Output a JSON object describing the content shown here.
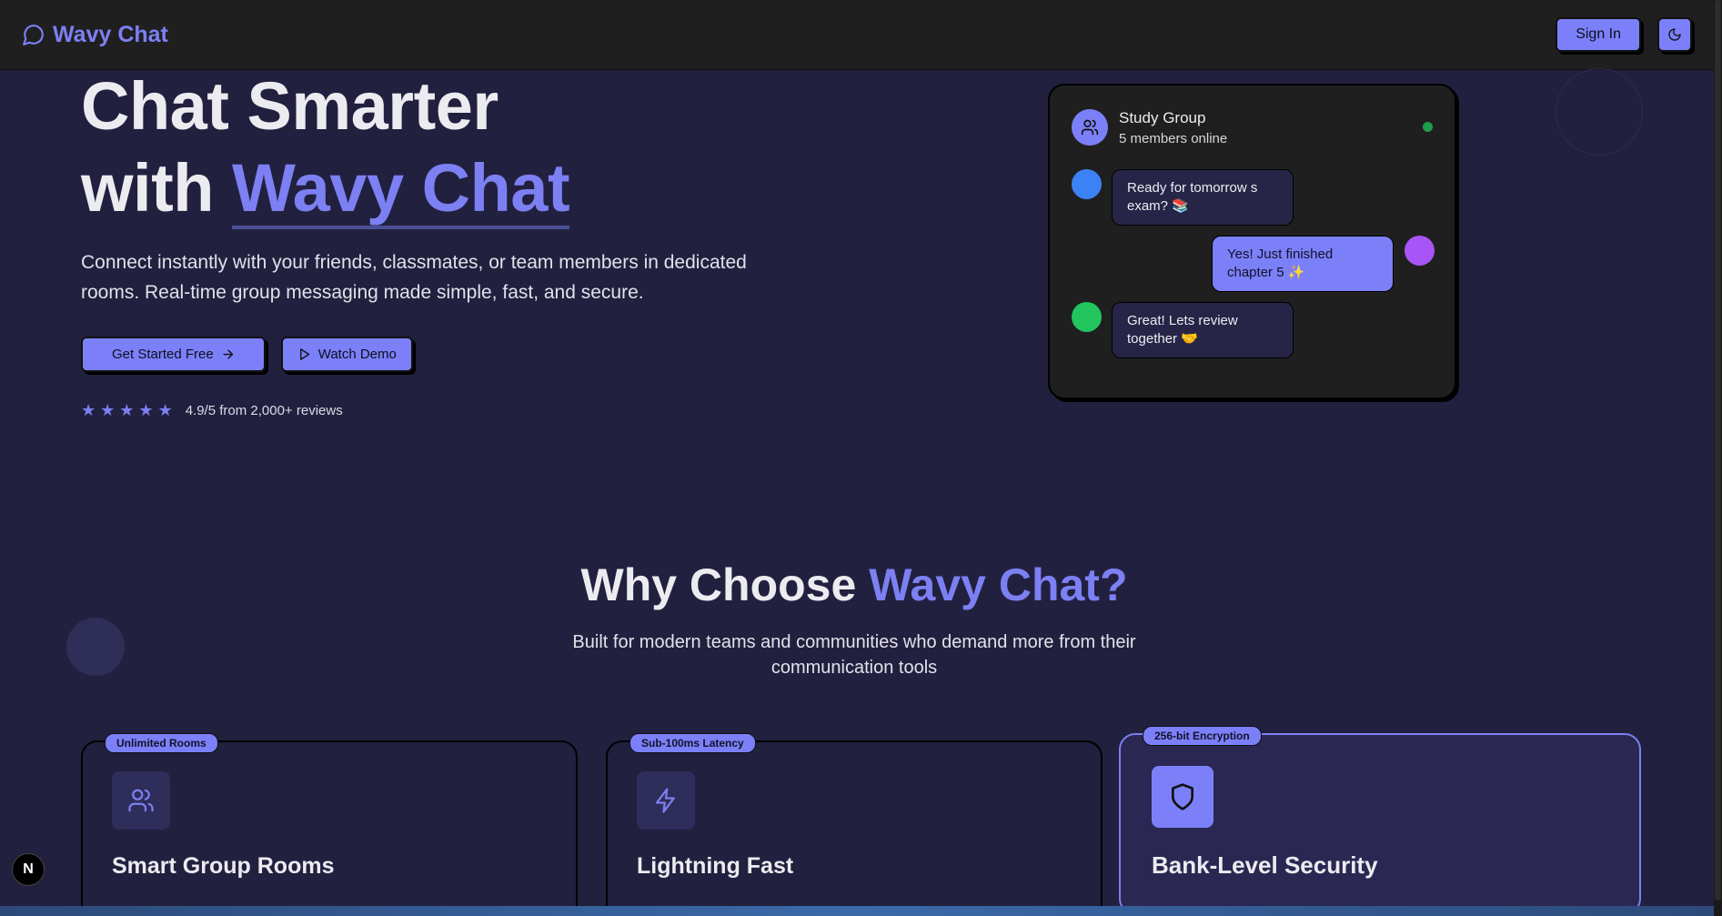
{
  "header": {
    "brand": "Wavy Chat",
    "sign_in": "Sign In"
  },
  "hero": {
    "title_line1": "Chat Smarter",
    "title_with": "with ",
    "title_accent": "Wavy Chat",
    "subtitle": "Connect instantly with your friends, classmates, or team members in dedicated rooms. Real-time group messaging made simple, fast, and secure.",
    "cta_primary": "Get Started Free",
    "cta_secondary": "Watch Demo",
    "rating_text": "4.9/5 from 2,000+ reviews",
    "stars": 5
  },
  "chat_preview": {
    "group_name": "Study Group",
    "status": "5 members online",
    "messages": [
      {
        "text": "Ready for tomorrow s exam? 📚",
        "side": "in",
        "avatar_color": "#3b82f6"
      },
      {
        "text": "Yes! Just finished chapter 5 ✨",
        "side": "out",
        "avatar_color": "#a855f7"
      },
      {
        "text": "Great! Lets review together 🤝",
        "side": "in",
        "avatar_color": "#22c55e"
      }
    ]
  },
  "why": {
    "title_plain": "Why Choose ",
    "title_accent": "Wavy Chat?",
    "subtitle": "Built for modern teams and communities who demand more from their communication tools"
  },
  "features": [
    {
      "badge": "Unlimited Rooms",
      "title": "Smart Group Rooms",
      "icon": "users-icon"
    },
    {
      "badge": "Sub-100ms Latency",
      "title": "Lightning Fast",
      "icon": "lightning-icon"
    },
    {
      "badge": "256-bit Encryption",
      "title": "Bank-Level Security",
      "icon": "shield-icon"
    }
  ],
  "dev_badge": "N",
  "colors": {
    "accent": "#7c80f2",
    "background": "#22203f",
    "header": "#1f1f1f"
  }
}
